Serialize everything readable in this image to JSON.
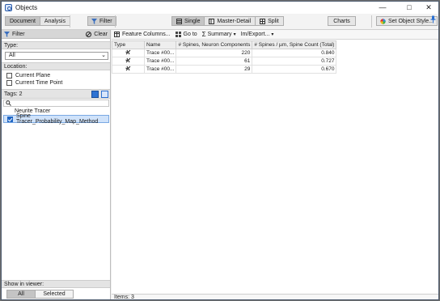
{
  "window": {
    "title": "Objects"
  },
  "toolbar": {
    "view_tabs": [
      "Document",
      "Analysis"
    ],
    "filter_label": "Filter",
    "layout_options": [
      "Single",
      "Master-Detail",
      "Split"
    ],
    "charts_label": "Charts",
    "object_style_label": "Set Object Style..."
  },
  "left_panel": {
    "header": "Filter",
    "clear_label": "Clear",
    "type_heading": "Type:",
    "type_value": "All",
    "location_heading": "Location:",
    "location_options": [
      {
        "label": "Current Plane",
        "checked": false
      },
      {
        "label": "Current Time Point",
        "checked": false
      }
    ],
    "tags_heading": "Tags: 2",
    "tags": [
      {
        "label": "Neurite Tracer",
        "checked": null
      },
      {
        "label": "Spine Tracer_Probability_Map_Method",
        "checked": true
      }
    ],
    "show_in_viewer_heading": "Show in viewer:",
    "show_options": [
      "All",
      "Selected"
    ]
  },
  "grid": {
    "toolbar": [
      "Feature Columns...",
      "Go to",
      "Summary",
      "Im/Export..."
    ],
    "columns": [
      "Type",
      "Name",
      "# Spines, Neuron Components",
      "# Spines / µm, Spine Count (Total)"
    ],
    "rows": [
      {
        "name": "Trace #00...",
        "spines": "220",
        "per_um": "0.840"
      },
      {
        "name": "Trace #00...",
        "spines": "61",
        "per_um": "0.727"
      },
      {
        "name": "Trace #00...",
        "spines": "29",
        "per_um": "0.670"
      }
    ],
    "status": "Items: 3"
  }
}
